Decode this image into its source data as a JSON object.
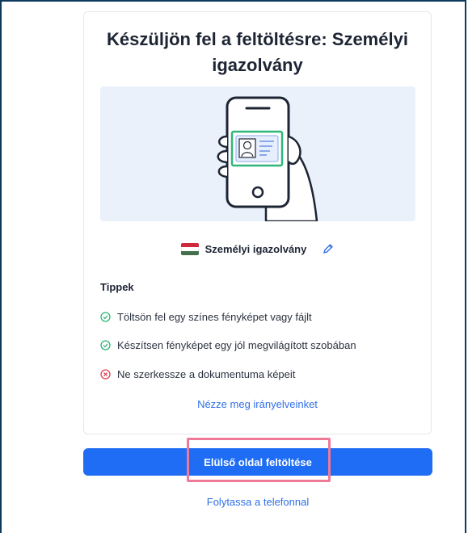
{
  "card": {
    "title_line1": "Készüljön fel a feltöltésre: Személyi",
    "title_line2": "igazolvány",
    "document_type": "Személyi igazolvány"
  },
  "tips": {
    "heading": "Tippek",
    "items": [
      {
        "text": "Töltsön fel egy színes fényképet vagy fájlt",
        "status": "ok",
        "icon": "check-circle-icon"
      },
      {
        "text": "Készítsen fényképet egy jól megvilágított szobában",
        "status": "ok",
        "icon": "check-circle-icon"
      },
      {
        "text": "Ne szerkessze a dokumentuma képeit",
        "status": "bad",
        "icon": "x-circle-icon"
      }
    ],
    "guidelines_link": "Nézze meg irányelveinket"
  },
  "actions": {
    "upload_front_label": "Elülső oldal feltöltése",
    "continue_phone_label": "Folytassa a telefonnal"
  },
  "colors": {
    "accent": "#1f6df4",
    "link": "#2f6fe8",
    "success": "#2fb67a",
    "error": "#e0475a",
    "highlight": "#ee7a98",
    "flag_red": "#cd2a3e",
    "flag_white": "#ffffff",
    "flag_green": "#436f4d"
  }
}
